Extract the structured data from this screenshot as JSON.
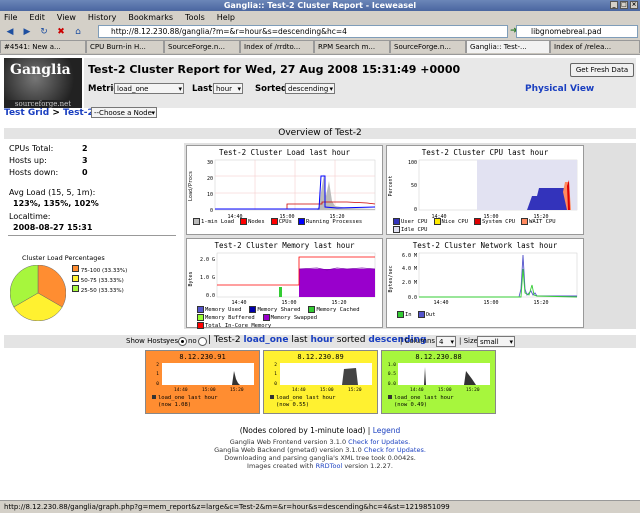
{
  "window": {
    "title": "Ganglia:: Test-2 Cluster Report - Iceweasel"
  },
  "menu": [
    "File",
    "Edit",
    "View",
    "History",
    "Bookmarks",
    "Tools",
    "Help"
  ],
  "nav": {
    "url": "http://8.12.230.88/ganglia/?m=&r=hour&s=descending&hc=4",
    "search": "libgnomebreal.pad"
  },
  "tabs": [
    "#4541: New a...",
    "CPU Burn-in H...",
    "SourceForge.n...",
    "Index of /rrdto...",
    "RPM Search m...",
    "SourceForge.n...",
    "Ganglia:: Test-...",
    "Index of /relea..."
  ],
  "header": {
    "title": "Test-2 Cluster Report for Wed, 27 Aug 2008 15:31:49 +0000",
    "fresh_button": "Get Fresh Data",
    "metric_label": "Metric",
    "metric_value": "load_one",
    "last_label": "Last",
    "last_value": "hour",
    "sorted_label": "Sorted",
    "sorted_value": "descending",
    "physical_view": "Physical View",
    "logo_name": "Ganglia",
    "logo_sub": "sourceforge.net"
  },
  "breadcrumb": {
    "grid": "Test Grid",
    "sep": ">",
    "cluster": "Test-2",
    "node_select": "--Choose a Node"
  },
  "overview": {
    "title": "Overview of Test-2",
    "cpus_label": "CPUs Total:",
    "cpus": "2",
    "hosts_up_label": "Hosts up:",
    "hosts_up": "3",
    "hosts_down_label": "Hosts down:",
    "hosts_down": "0",
    "avg_load_label": "Avg Load (15, 5, 1m):",
    "avg_load": "123%, 135%, 102%",
    "localtime_label": "Localtime:",
    "localtime": "2008-08-27 15:31",
    "pie_title": "Cluster Load Percentages",
    "pie_legend": [
      "75-100 (33.33%)",
      "50-75 (33.33%)",
      "25-50 (33.33%)"
    ],
    "pie_colors": [
      "#ff8d31",
      "#fff130",
      "#a7f63d"
    ]
  },
  "graphs": {
    "load": {
      "title": "Test-2 Cluster Load last hour",
      "ylabel": "Load/Procs",
      "yticks": [
        "30",
        "20",
        "10",
        "0"
      ],
      "xticks": [
        "14:40",
        "15:00",
        "15:20"
      ],
      "legend": [
        "1-min Load",
        "Nodes",
        "CPUs",
        "Running Processes"
      ],
      "legend_colors": [
        "#bbbbbb",
        "#ff0000",
        "#ff0000",
        "#0000ff"
      ]
    },
    "cpu": {
      "title": "Test-2 Cluster CPU last hour",
      "ylabel": "Percent",
      "yticks": [
        "100",
        "50",
        "0"
      ],
      "xticks": [
        "14:40",
        "15:00",
        "15:20"
      ],
      "legend": [
        "User CPU",
        "Nice CPU",
        "System CPU",
        "WAIT CPU",
        "Idle CPU"
      ],
      "legend_colors": [
        "#3333bb",
        "#ffea00",
        "#dd0000",
        "#ff8a60",
        "#e2e2f2"
      ]
    },
    "memory": {
      "title": "Test-2 Cluster Memory last hour",
      "ylabel": "Bytes",
      "yticks": [
        "2.0 G",
        "1.0 G",
        "0.0"
      ],
      "xticks": [
        "14:40",
        "15:00",
        "15:20"
      ],
      "legend": [
        "Memory Used",
        "Memory Shared",
        "Memory Cached",
        "Memory Buffered",
        "Memory Swapped",
        "Total In-Core Memory"
      ],
      "legend_colors": [
        "#5555cc",
        "#0000aa",
        "#33cc33",
        "#99ff33",
        "#9900cc",
        "#ff0000"
      ]
    },
    "network": {
      "title": "Test-2 Cluster Network last hour",
      "ylabel": "Bytes/sec",
      "yticks": [
        "6.0 M",
        "4.0 M",
        "2.0 M",
        "0.0"
      ],
      "xticks": [
        "14:40",
        "15:00",
        "15:20"
      ],
      "legend": [
        "In",
        "Out"
      ],
      "legend_colors": [
        "#33cc33",
        "#5555cc"
      ]
    }
  },
  "hosts_bar": {
    "show_hosts": "Show Hosts:",
    "yes": "yes",
    "no": "no",
    "summary_a": "| Test-2",
    "metric": "load_one",
    "summary_b": "last",
    "range": "hour",
    "summary_c": "sorted",
    "sort": "descending",
    "columns_label": "| Columns",
    "columns_value": "4",
    "size_label": "| Size",
    "size_value": "small"
  },
  "hosts": [
    {
      "ip": "8.12.230.91",
      "color": "#ff8d31",
      "line1": "load_one last hour",
      "line2": "(now 1.08)",
      "yticks": [
        "2",
        "1",
        "0"
      ]
    },
    {
      "ip": "8.12.230.89",
      "color": "#fff130",
      "line1": "load_one last hour",
      "line2": "(now 0.55)",
      "yticks": [
        "2",
        "1",
        "0"
      ]
    },
    {
      "ip": "8.12.230.88",
      "color": "#a7f63d",
      "line1": "load_one last hour",
      "line2": "(now 0.49)",
      "yticks": [
        "1.0",
        "0.5",
        "0.0"
      ]
    }
  ],
  "xticks_small": [
    "14:40",
    "15:00",
    "15:20"
  ],
  "legend_note": {
    "text": "(Nodes colored by 1-minute load) |",
    "link": "Legend"
  },
  "footer": {
    "line1": "Ganglia Web Frontend version 3.1.0",
    "link1": "Check for Updates.",
    "line2": "Ganglia Web Backend (gmetad) version 3.1.0",
    "link2": "Check for Updates.",
    "line3": "Downloading and parsing ganglia's XML tree took 0.0042s.",
    "line4": "Images created with",
    "link4": "RRDTool",
    "line4b": "version 1.2.27."
  },
  "status": "http://8.12.230.88/ganglia/graph.php?g=mem_report&z=large&c=Test-2&m=&r=hour&s=descending&hc=4&st=1219851099"
}
